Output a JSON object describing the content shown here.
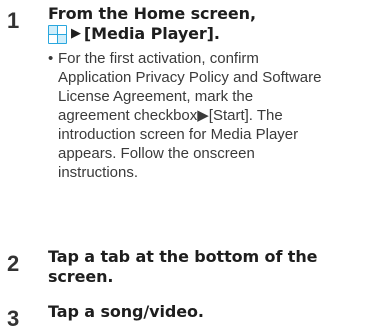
{
  "steps": [
    {
      "number": "1",
      "title_line1": "From the Home screen,",
      "title_line2_arrow": "▶",
      "title_line2_text": "[Media Player].",
      "icon": "apps-grid-icon",
      "icon_color": "#2aa7de",
      "bullet": "•",
      "bullet_lines": [
        "For the first activation, confirm",
        "Application Privacy Policy and Software",
        "License Agreement, mark the",
        "agreement checkbox▶[Start]. The",
        "introduction screen for Media Player",
        "appears. Follow the onscreen",
        "instructions."
      ]
    },
    {
      "number": "2",
      "title_lines": [
        "Tap a tab at the bottom of the",
        "screen."
      ]
    },
    {
      "number": "3",
      "title_lines": [
        "Tap a song/video."
      ]
    }
  ]
}
